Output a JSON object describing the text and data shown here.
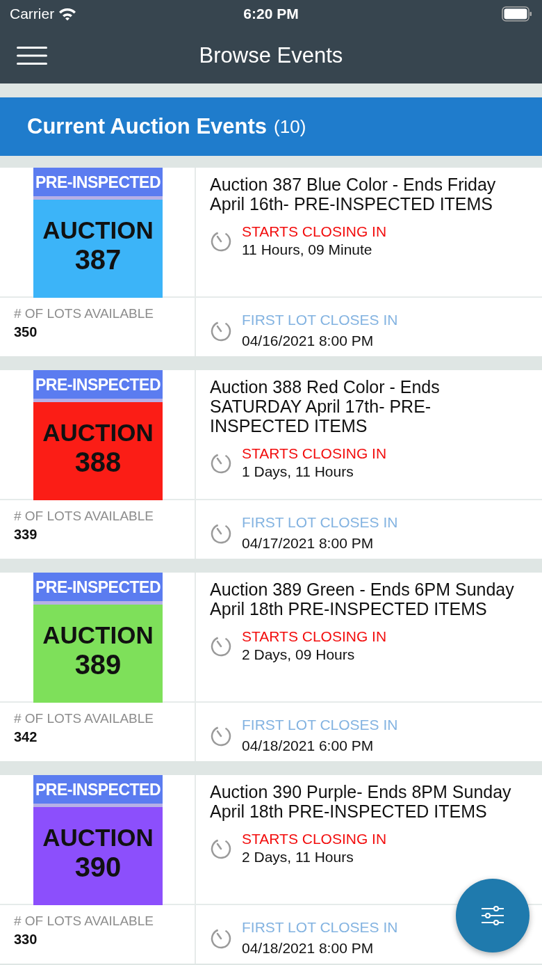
{
  "status_bar": {
    "carrier": "Carrier",
    "time": "6:20 PM"
  },
  "nav": {
    "title": "Browse Events"
  },
  "section": {
    "title": "Current Auction Events",
    "count": "(10)"
  },
  "events": [
    {
      "thumb": {
        "banner": "PRE-INSPECTED",
        "label": "AUCTION",
        "number": "387",
        "color": "#3cb4f8"
      },
      "title": "Auction 387 Blue Color - Ends Friday April 16th- PRE-INSPECTED ITEMS",
      "closing_label": "STARTS CLOSING IN",
      "closing_value": "11 Hours, 09 Minute",
      "lots_label": "# OF LOTS AVAILABLE",
      "lots": "350",
      "first_label": "FIRST LOT CLOSES IN",
      "first_value": "04/16/2021 8:00 PM"
    },
    {
      "thumb": {
        "banner": "PRE-INSPECTED",
        "label": "AUCTION",
        "number": "388",
        "color": "#fb1d16"
      },
      "title": "Auction 388 Red Color - Ends SATURDAY April 17th- PRE-INSPECTED ITEMS",
      "closing_label": "STARTS CLOSING IN",
      "closing_value": "1 Days, 11 Hours",
      "lots_label": "# OF LOTS AVAILABLE",
      "lots": "339",
      "first_label": "FIRST LOT CLOSES IN",
      "first_value": "04/17/2021 8:00 PM"
    },
    {
      "thumb": {
        "banner": "PRE-INSPECTED",
        "label": "AUCTION",
        "number": "389",
        "color": "#7ee05a"
      },
      "title": "Auction 389 Green - Ends 6PM Sunday April 18th PRE-INSPECTED ITEMS",
      "closing_label": "STARTS CLOSING IN",
      "closing_value": "2 Days, 09 Hours",
      "lots_label": "# OF LOTS AVAILABLE",
      "lots": "342",
      "first_label": "FIRST LOT CLOSES IN",
      "first_value": "04/18/2021 6:00 PM"
    },
    {
      "thumb": {
        "banner": "PRE-INSPECTED",
        "label": "AUCTION",
        "number": "390",
        "color": "#8c4ffc"
      },
      "title": "Auction 390 Purple- Ends 8PM Sunday April 18th PRE-INSPECTED ITEMS",
      "closing_label": "STARTS CLOSING IN",
      "closing_value": "2 Days, 11 Hours",
      "lots_label": "# OF LOTS AVAILABLE",
      "lots": "330",
      "first_label": "FIRST LOT CLOSES IN",
      "first_value": "04/18/2021 8:00 PM"
    }
  ]
}
